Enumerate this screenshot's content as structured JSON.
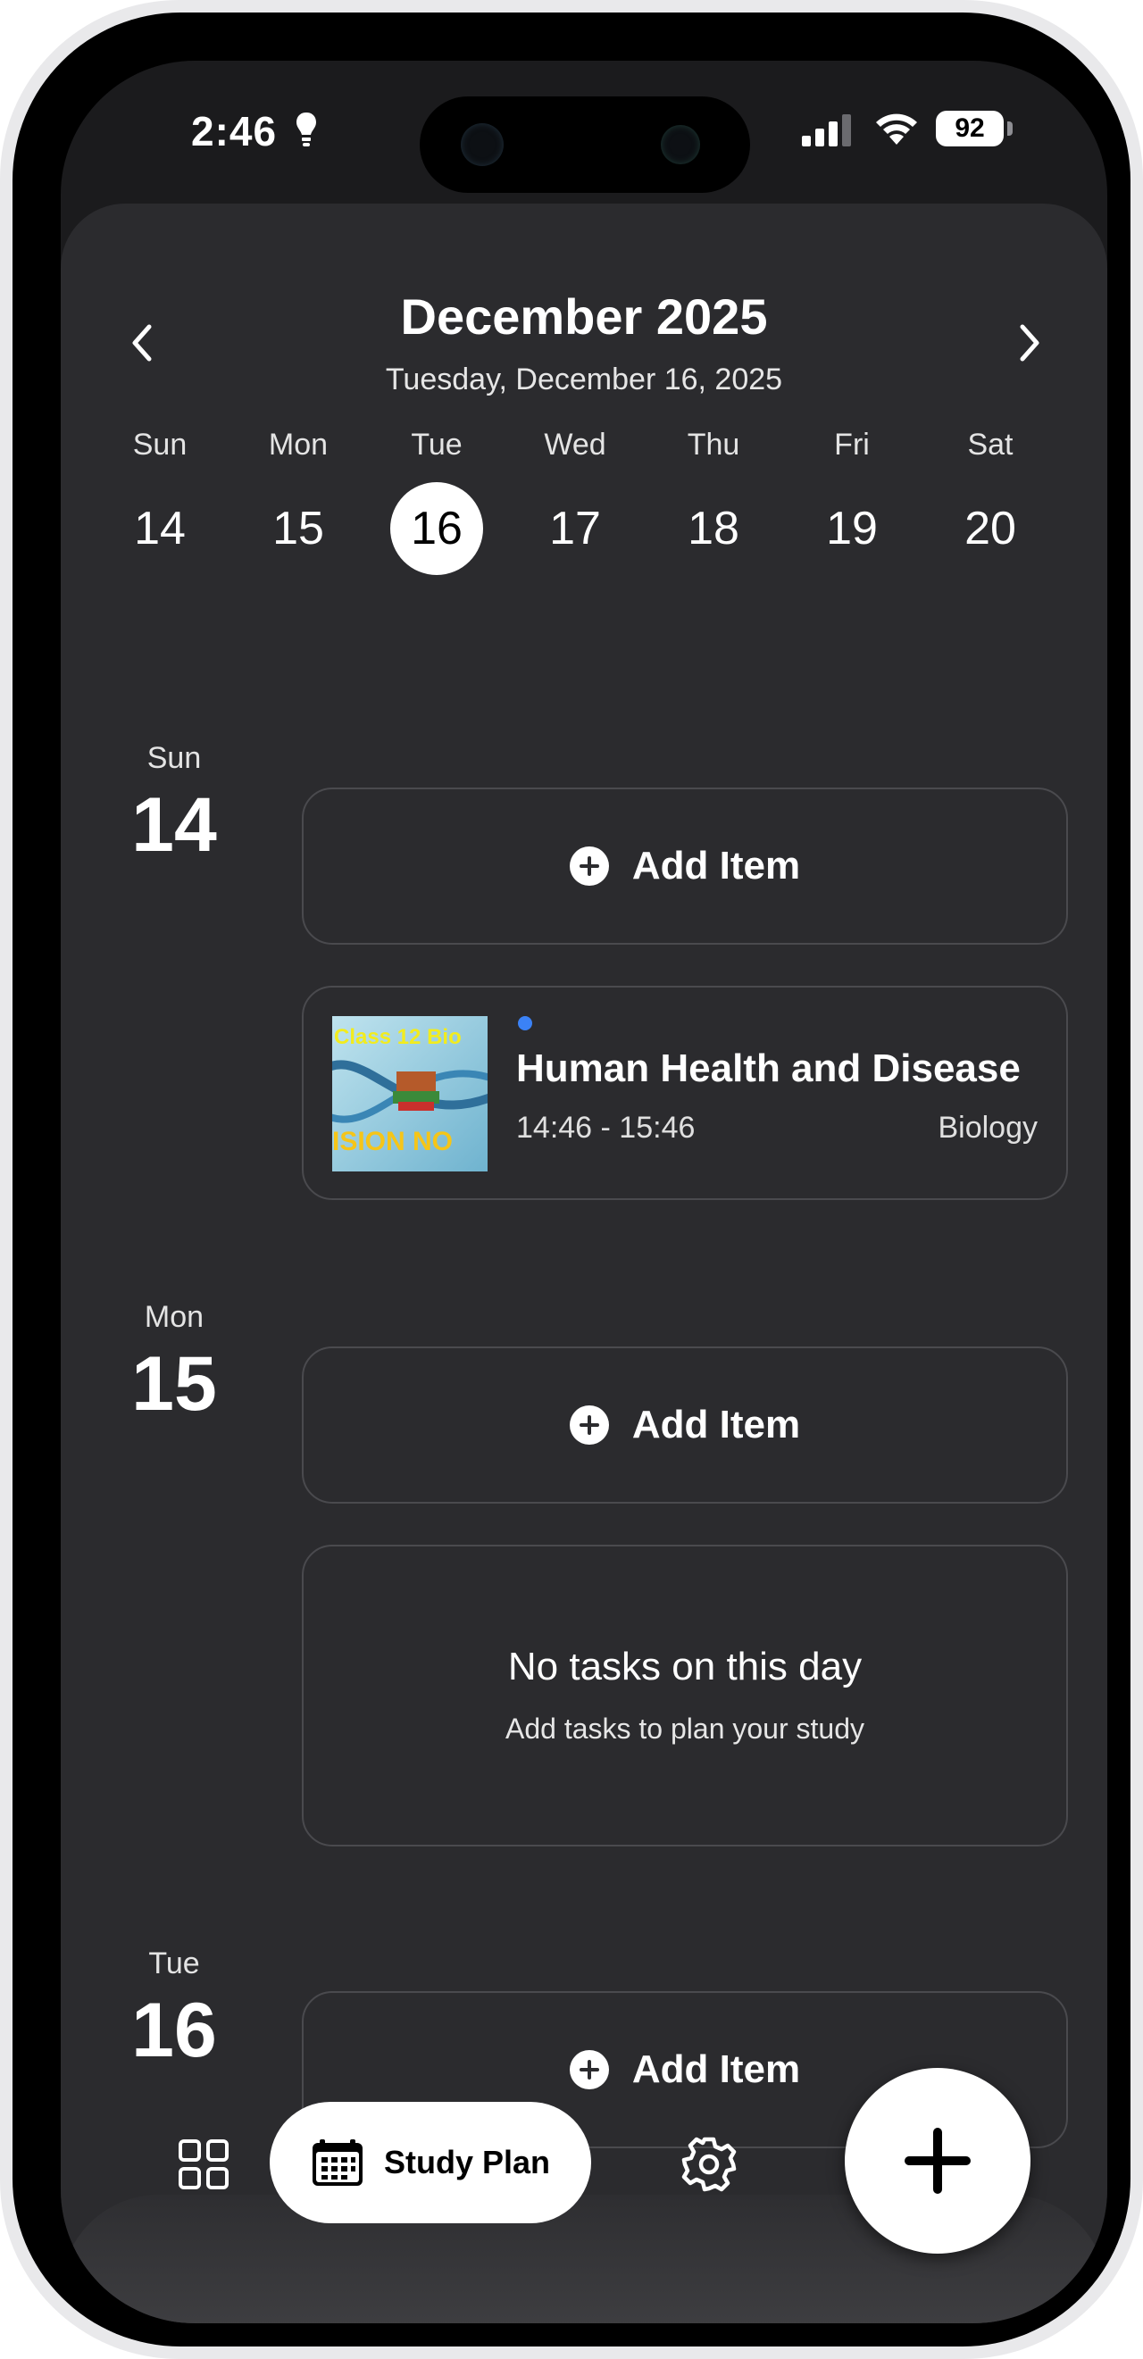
{
  "status_bar": {
    "time": "2:46",
    "battery": "92",
    "icons": [
      "lightbulb-icon",
      "cellular-signal-icon",
      "wifi-icon",
      "battery-icon"
    ]
  },
  "header": {
    "month_title": "December 2025",
    "selected_date": "Tuesday, December 16, 2025",
    "prev_icon": "chevron-left-icon",
    "next_icon": "chevron-right-icon"
  },
  "week": [
    {
      "name": "Sun",
      "num": "14"
    },
    {
      "name": "Mon",
      "num": "15"
    },
    {
      "name": "Tue",
      "num": "16",
      "selected": true
    },
    {
      "name": "Wed",
      "num": "17"
    },
    {
      "name": "Thu",
      "num": "18"
    },
    {
      "name": "Fri",
      "num": "19"
    },
    {
      "name": "Sat",
      "num": "20"
    }
  ],
  "days": [
    {
      "name": "Sun",
      "num": "14",
      "add_label": "Add Item",
      "task": {
        "title": "Human Health and Disease",
        "time": "14:46 - 15:46",
        "subject": "Biology",
        "dot_color": "#3b82f6",
        "thumbnail_text_top": "Class 12 Bio",
        "thumbnail_text_bottom": "ISION NO"
      }
    },
    {
      "name": "Mon",
      "num": "15",
      "add_label": "Add Item",
      "empty_title": "No tasks on this day",
      "empty_subtitle": "Add tasks to plan your study"
    },
    {
      "name": "Tue",
      "num": "16",
      "add_label": "Add Item"
    }
  ],
  "tab_bar": {
    "grid_icon": "grid-icon",
    "active_label": "Study Plan",
    "active_icon": "calendar-icon",
    "settings_icon": "gear-icon",
    "fab_icon": "plus-icon"
  },
  "colors": {
    "background": "#2b2b2e",
    "card_border": "#4a4a4e",
    "accent_dot": "#3b82f6"
  }
}
